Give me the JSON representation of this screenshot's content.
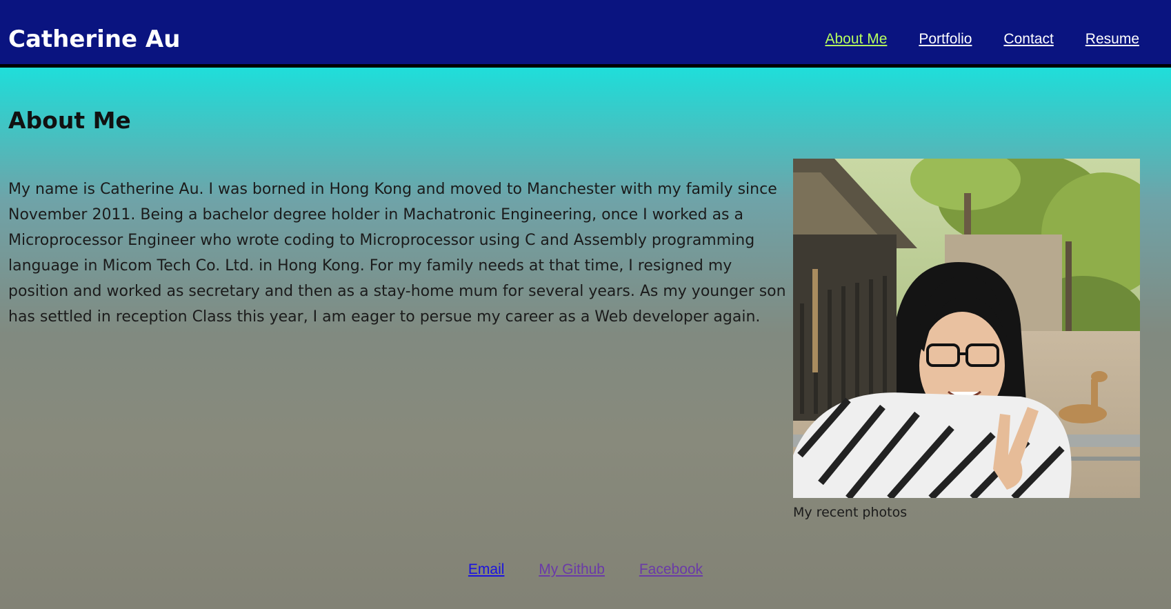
{
  "header": {
    "site_title": "Catherine Au",
    "nav": [
      {
        "label": "About Me",
        "active": true
      },
      {
        "label": "Portfolio",
        "active": false
      },
      {
        "label": "Contact",
        "active": false
      },
      {
        "label": "Resume",
        "active": false
      }
    ]
  },
  "main": {
    "title": "About Me",
    "bio": "My name is Catherine Au. I was borned in Hong Kong and moved to Manchester with my family since November 2011. Being a bachelor degree holder in Machatronic Engineering, once I worked as a Microprocessor Engineer who wrote coding to Microprocessor using C and Assembly programming language in Micom Tech Co. Ltd. in Hong Kong. For my family needs at that time, I resigned my position and worked as secretary and then as a stay-home mum for several years. As my younger son has settled in reception Class this year, I am eager to persue my career as a Web developer again.",
    "photo_caption": "My recent photos"
  },
  "footer": {
    "links": [
      {
        "label": "Email"
      },
      {
        "label": " My Github"
      },
      {
        "label": " Facebook"
      }
    ]
  },
  "colors": {
    "header_bg": "#0a1480",
    "nav_active": "#b6ff5e",
    "link": "#1a12e0",
    "link_visited": "#6a3aa8"
  }
}
